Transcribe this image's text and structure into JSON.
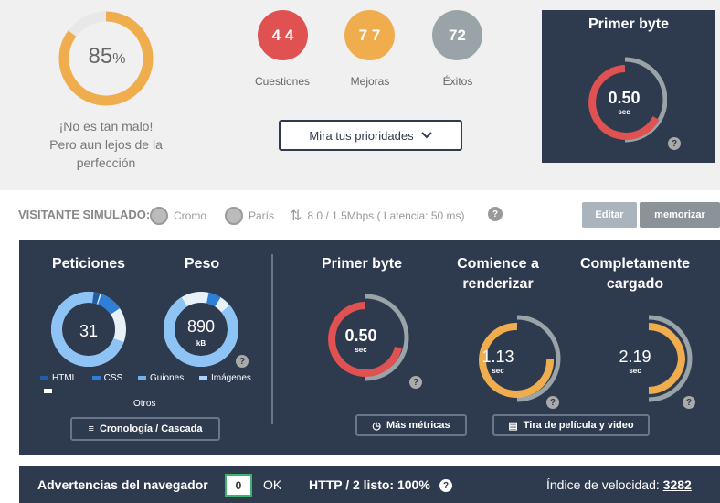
{
  "summary": {
    "score_value": "85",
    "score_unit": "%",
    "score_fraction": 0.85,
    "message_line1": "¡No es tan malo!",
    "message_line2": "Pero aun lejos de la",
    "message_line3": "perfección",
    "bubbles": [
      {
        "value": "4 4",
        "label": "Cuestiones",
        "color": "#e05252"
      },
      {
        "value": "7 7",
        "label": "Mejoras",
        "color": "#f0ad4e"
      },
      {
        "value": "72",
        "label": "Éxitos",
        "color": "#9aa4a8"
      }
    ],
    "priorities_button": "Mira tus prioridades",
    "first_byte_title": "Primer byte",
    "first_byte_value": "0.50",
    "first_byte_unit": "sec",
    "help_icon": "?"
  },
  "simulated": {
    "label": "VISITANTE SIMULADO:",
    "browser": "Cromo",
    "location": "París",
    "connection": "8.0 / 1.5Mbps ( Latencia: 50 ms)",
    "edit_button": "Editar",
    "memorize_button": "memorizar"
  },
  "metrics": {
    "requests_title": "Peticiones",
    "requests_value": "31",
    "weight_title": "Peso",
    "weight_value": "890",
    "weight_unit": "kB",
    "legend": [
      "HTML",
      "CSS",
      "Guiones",
      "Imágenes",
      "Otros"
    ],
    "legend_colors": [
      "#1f5fa8",
      "#2f7fd6",
      "#6fb0ee",
      "#a9d3fb",
      "#ffffff"
    ],
    "first_byte_title": "Primer byte",
    "first_byte_value": "0.50",
    "render_title_1": "Comience a",
    "render_title_2": "renderizar",
    "render_value": "1.13",
    "loaded_title_1": "Completamente",
    "loaded_title_2": "cargado",
    "loaded_value": "2.19",
    "unit": "sec",
    "timeline_button": "Cronología / Cascada",
    "more_metrics_button": "Más métricas",
    "filmstrip_button": "Tira de película y video"
  },
  "footer": {
    "warnings_label": "Advertencias del navegador",
    "warnings_count": "0",
    "ok_label": "OK",
    "http2_label": "HTTP / 2 listo: 100%",
    "speed_label": "Índice de velocidad:",
    "speed_value": "3282"
  }
}
